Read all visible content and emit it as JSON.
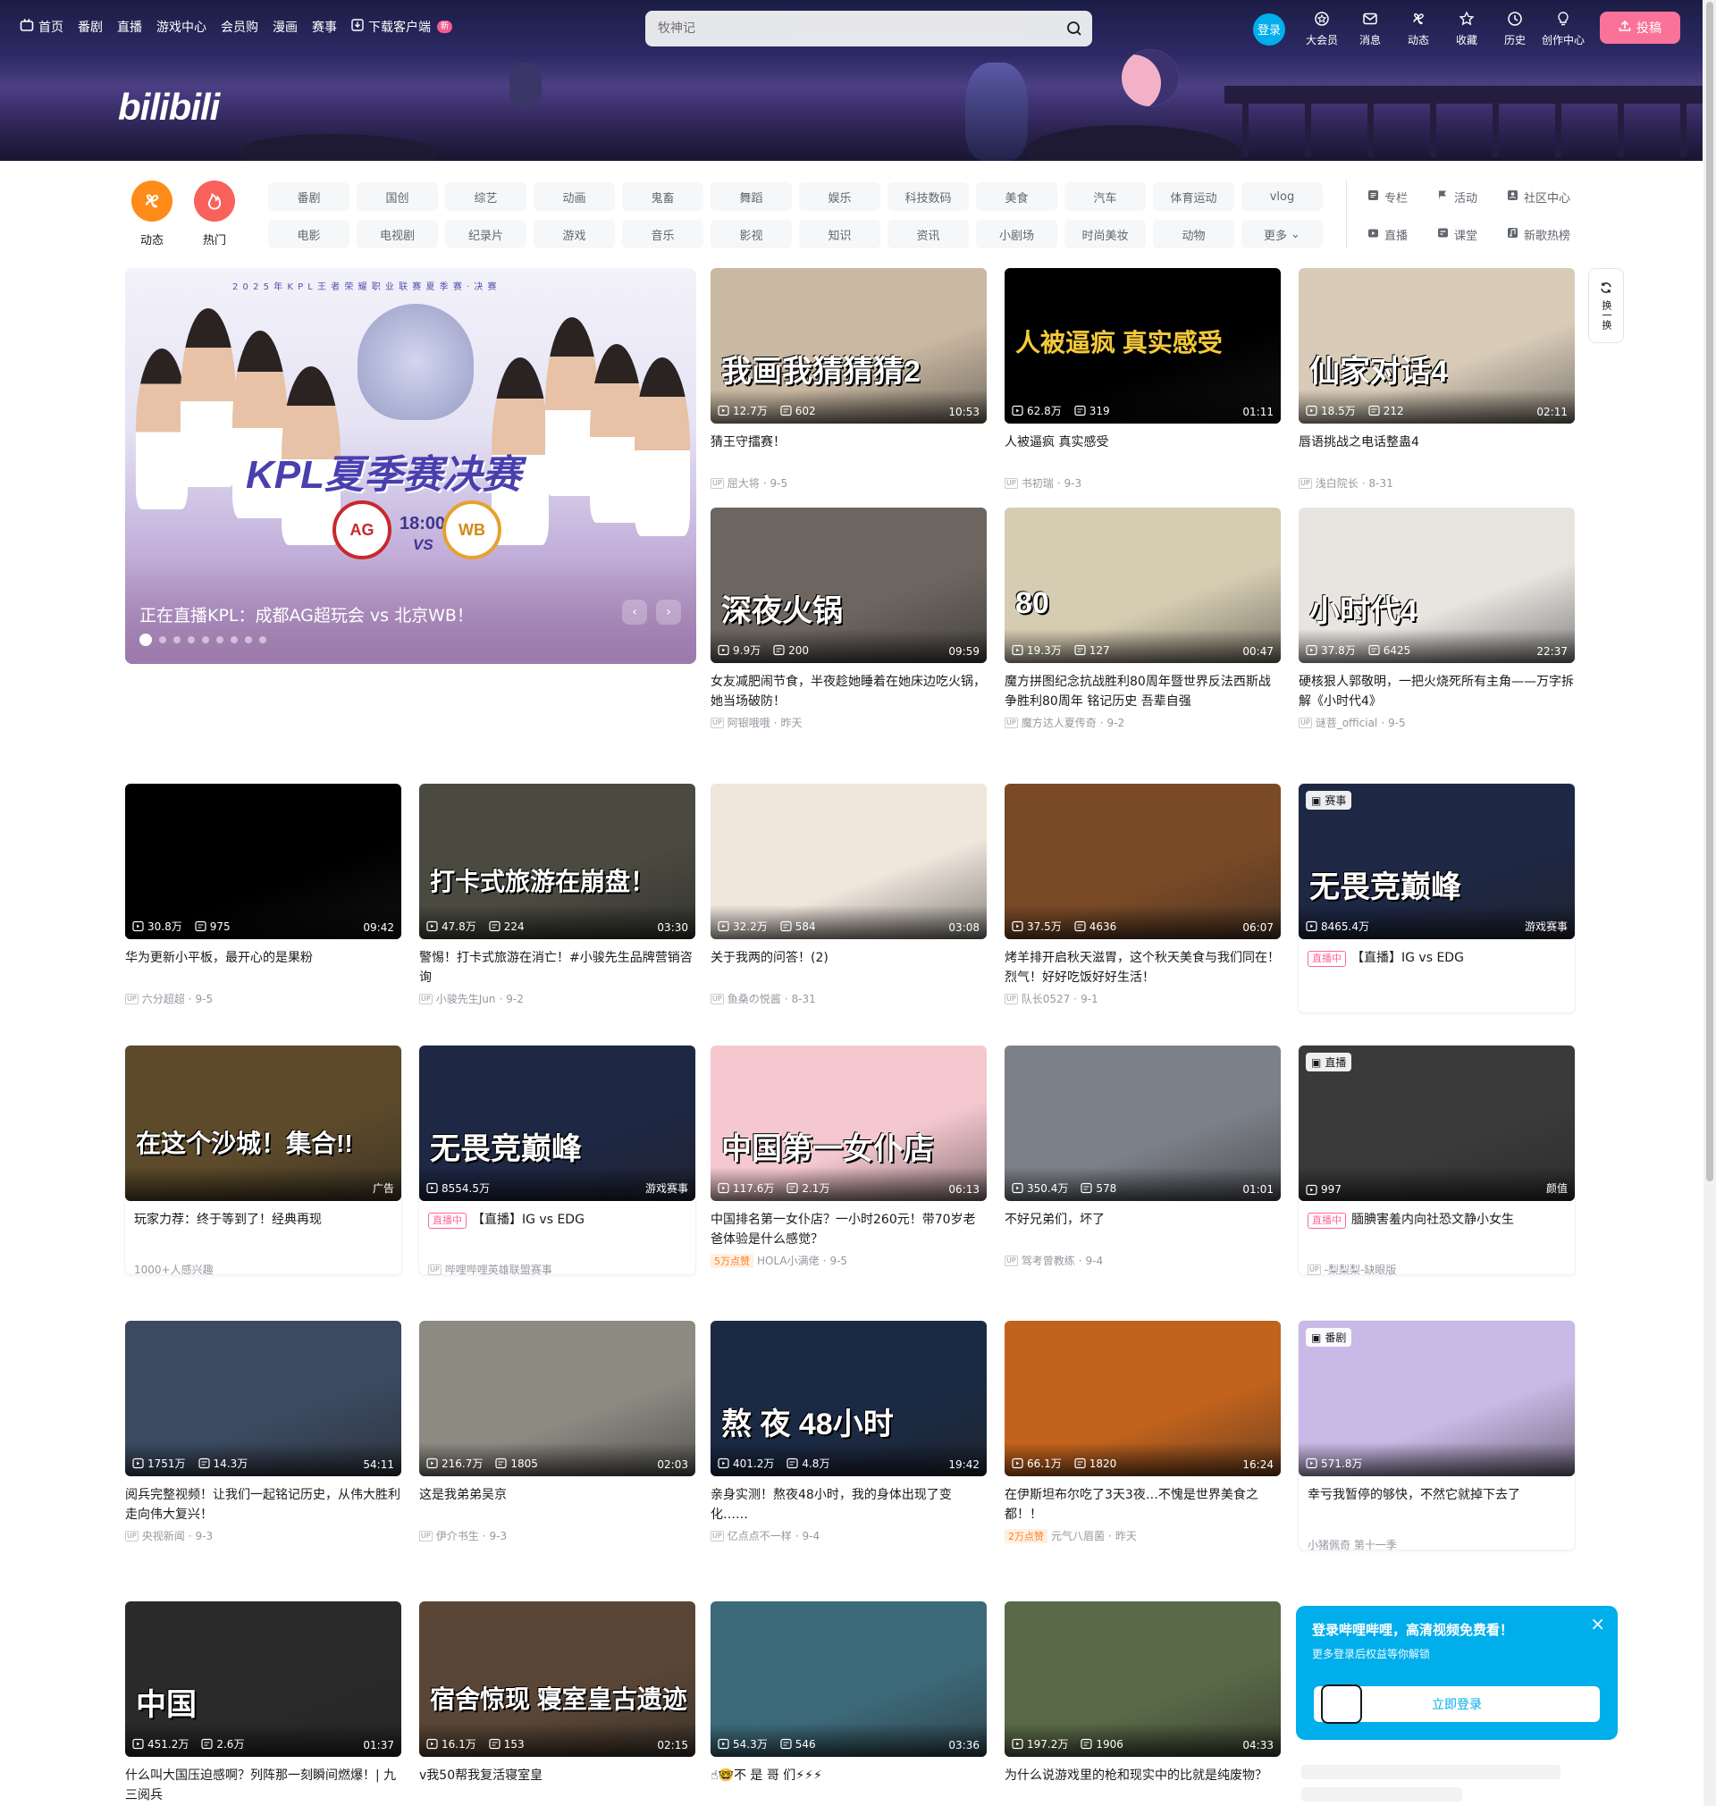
{
  "nav": {
    "items": [
      "首页",
      "番剧",
      "直播",
      "游戏中心",
      "会员购",
      "漫画",
      "赛事",
      "下载客户端"
    ],
    "new_badge": "新",
    "search_placeholder": "牧神记",
    "login": "登录",
    "right_items": [
      "大会员",
      "消息",
      "动态",
      "收藏",
      "历史",
      "创作中心"
    ],
    "upload": "投稿",
    "logo": "bilibili"
  },
  "channels": {
    "main": [
      {
        "label": "动态",
        "color": "#ff8c1a"
      },
      {
        "label": "热门",
        "color": "#f9625a"
      }
    ],
    "tags": [
      "番剧",
      "国创",
      "综艺",
      "动画",
      "鬼畜",
      "舞蹈",
      "娱乐",
      "科技数码",
      "美食",
      "汽车",
      "体育运动",
      "vlog",
      "电影",
      "电视剧",
      "纪录片",
      "游戏",
      "音乐",
      "影视",
      "知识",
      "资讯",
      "小剧场",
      "时尚美妆",
      "动物",
      "更多"
    ],
    "right": [
      "专栏",
      "活动",
      "社区中心",
      "直播",
      "课堂",
      "新歌热榜"
    ]
  },
  "carousel": {
    "title": "正在直播KPL：成都AG超玩会 vs 北京WB！",
    "poster_text": "KPL夏季赛决赛",
    "time": "18:00",
    "vs": "VS",
    "team_a": "AG",
    "team_b": "WB",
    "header_text": "2 0 2 5 年 K P L 王 者 荣 耀 职 业 联 赛 夏 季 赛 · 决 赛",
    "prev": "‹",
    "next": "›"
  },
  "refresh": {
    "label": "换一换"
  },
  "videos": [
    {
      "title": "猜王守擂赛！",
      "views": "12.7万",
      "danmaku": "602",
      "duration": "10:53",
      "author": "屈大将",
      "date": "9-5",
      "overlay": "我画我猜猜猜2",
      "bg": "#c9b8a2"
    },
    {
      "title": "人被逼疯 真实感受",
      "views": "62.8万",
      "danmaku": "319",
      "duration": "01:11",
      "author": "书初瑞",
      "date": "9-3",
      "overlay": "人被逼疯 真实感受",
      "bg": "#000000"
    },
    {
      "title": "唇语挑战之电话整蛊4",
      "views": "18.5万",
      "danmaku": "212",
      "duration": "02:11",
      "author": "浅白院长",
      "date": "8-31",
      "overlay": "仙家对话4",
      "bg": "#d8cbb8"
    },
    {
      "title": "女友减肥闹节食，半夜趁她睡着在她床边吃火锅，她当场破防！",
      "views": "9.9万",
      "danmaku": "200",
      "duration": "09:59",
      "author": "阿银哦哦",
      "date": "昨天",
      "overlay": "深夜火锅",
      "bg": "#6d6660"
    },
    {
      "title": "魔方拼图纪念抗战胜利80周年暨世界反法西斯战争胜利80周年 铭记历史 吾辈自强",
      "views": "19.3万",
      "danmaku": "127",
      "duration": "00:47",
      "author": "魔方达人夏传奇",
      "date": "9-2",
      "overlay": "80",
      "bg": "#d6ccb2"
    },
    {
      "title": "硬核狠人郭敬明，一把火烧死所有主角——万字拆解《小时代4》",
      "views": "37.8万",
      "danmaku": "6425",
      "duration": "22:37",
      "author": "谜菩_official",
      "date": "9-5",
      "overlay": "小时代4",
      "bg": "#e8e4e0"
    },
    {
      "title": "华为更新小平板，最开心的是果粉",
      "views": "30.8万",
      "danmaku": "975",
      "duration": "09:42",
      "author": "六分超超",
      "date": "9-5",
      "overlay": "",
      "bg": "#000000"
    },
    {
      "title": "警惕！打卡式旅游在消亡！#小骏先生品牌营销咨询",
      "views": "47.8万",
      "danmaku": "224",
      "duration": "03:30",
      "author": "小骏先生Jun",
      "date": "9-2",
      "overlay": "打卡式旅游在崩盘！",
      "bg": "#4a4a40"
    },
    {
      "title": "关于我两的问答！(2)",
      "views": "32.2万",
      "danmaku": "584",
      "duration": "03:08",
      "author": "鱼桑の悦酱",
      "date": "8-31",
      "overlay": "",
      "bg": "#efe6dc"
    },
    {
      "title": "烤羊排开启秋天滋胃，这个秋天美食与我们同在！烈气！好好吃饭好好生活！",
      "views": "37.5万",
      "danmaku": "4636",
      "duration": "06:07",
      "author": "队长0527",
      "date": "9-1",
      "overlay": "",
      "bg": "#7a4a26"
    },
    {
      "title": "【直播】IG vs EDG",
      "views": "8465.4万",
      "danmaku": "",
      "duration": "游戏赛事",
      "author": "",
      "date": "",
      "overlay": "无畏竞巅峰",
      "bg": "#1e2744",
      "tag": "赛事",
      "live": "直播中"
    },
    {
      "title": "玩家力荐：终于等到了！经典再现",
      "views": "",
      "danmaku": "",
      "duration": "广告",
      "author": "1000+人感兴趣",
      "date": "",
      "overlay": "在这个沙城！集合!!",
      "bg": "#5c4a2a"
    },
    {
      "title": "【直播】IG vs EDG",
      "views": "8554.5万",
      "danmaku": "",
      "duration": "游戏赛事",
      "author": "哔哩哔哩英雄联盟赛事",
      "date": "",
      "overlay": "无畏竞巅峰",
      "bg": "#1e2744",
      "live": "直播中"
    },
    {
      "title": "中国排名第一女仆店？一小时260元！带70岁老爸体验是什么感觉？",
      "views": "117.6万",
      "danmaku": "2.1万",
      "duration": "06:13",
      "author": "HOLA小满佬",
      "date": "9-5",
      "overlay": "中国第一女仆店",
      "bg": "#f5c8cf",
      "hot": "5万点赞"
    },
    {
      "title": "不好兄弟们，坏了",
      "views": "350.4万",
      "danmaku": "578",
      "duration": "01:01",
      "author": "驾考曾教练",
      "date": "9-4",
      "overlay": "",
      "bg": "#7c8088"
    },
    {
      "title": "腼腆害羞内向社恐文静小女生",
      "views": "997",
      "danmaku": "",
      "duration": "颜值",
      "author": "-梨梨梨-缺眼版",
      "date": "",
      "overlay": "",
      "bg": "#3a3a3a",
      "tag": "直播",
      "live": "直播中"
    },
    {
      "title": "阅兵完整视频！让我们一起铭记历史，从伟大胜利走向伟大复兴！",
      "views": "1751万",
      "danmaku": "14.3万",
      "duration": "54:11",
      "author": "央视新闻",
      "date": "9-3",
      "overlay": "",
      "bg": "#3b4a60"
    },
    {
      "title": "这是我弟弟吴京",
      "views": "216.7万",
      "danmaku": "1805",
      "duration": "02:03",
      "author": "伊介书生",
      "date": "9-3",
      "overlay": "",
      "bg": "#8d8a82"
    },
    {
      "title": "亲身实测！熬夜48小时，我的身体出现了变化……",
      "views": "401.2万",
      "danmaku": "4.8万",
      "duration": "19:42",
      "author": "亿点点不一样",
      "date": "9-4",
      "overlay": "熬 夜 48小时",
      "bg": "#1b2a44"
    },
    {
      "title": "在伊斯坦布尔吃了3天3夜…不愧是世界美食之都！！",
      "views": "66.1万",
      "danmaku": "1820",
      "duration": "16:24",
      "author": "元气八眉菌",
      "date": "昨天",
      "overlay": "",
      "bg": "#c2631d",
      "hot": "2万点赞"
    },
    {
      "title": "幸亏我暂停的够快，不然它就掉下去了",
      "views": "571.8万",
      "danmaku": "",
      "duration": "",
      "author": "小猪佩奇 第十一季",
      "date": "",
      "overlay": "",
      "bg": "#c9b9e6",
      "tag": "番剧"
    },
    {
      "title": "什么叫大国压迫感啊？列阵那一刻瞬间燃爆！| 九三阅兵",
      "views": "451.2万",
      "danmaku": "2.6万",
      "duration": "01:37",
      "author": "",
      "date": "",
      "overlay": "中国",
      "bg": "#2a2a2a"
    },
    {
      "title": "v我50帮我复活寝室皇",
      "views": "16.1万",
      "danmaku": "153",
      "duration": "02:15",
      "author": "",
      "date": "",
      "overlay": "宿舍惊现 寝室皇古遗迹",
      "bg": "#5a4636"
    },
    {
      "title": "☝🤓不 是 哥 们⚡⚡⚡",
      "views": "54.3万",
      "danmaku": "546",
      "duration": "03:36",
      "author": "",
      "date": "",
      "overlay": "",
      "bg": "#3d6a7a"
    },
    {
      "title": "为什么说游戏里的枪和现实中的比就是纯废物？",
      "views": "197.2万",
      "danmaku": "1906",
      "duration": "04:33",
      "author": "",
      "date": "",
      "overlay": "",
      "bg": "#5a6a48"
    }
  ],
  "popup": {
    "heading": "登录哔哩哔哩，高清视频免费看！",
    "sub": "更多登录后权益等你解锁",
    "button": "立即登录",
    "close": "×"
  }
}
